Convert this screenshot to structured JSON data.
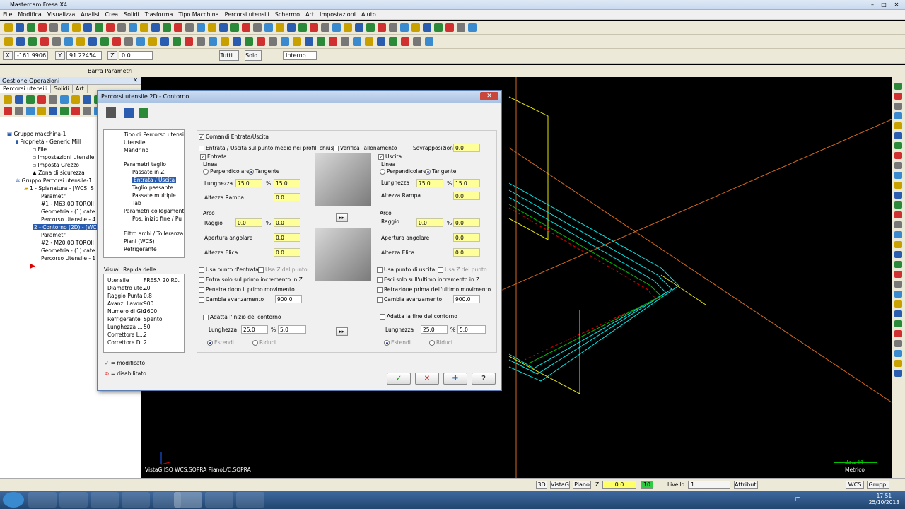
{
  "window": {
    "title": "Mastercam Fresa X4"
  },
  "menu": [
    "File",
    "Modifica",
    "Visualizza",
    "Analisi",
    "Crea",
    "Solidi",
    "Trasforma",
    "Tipo Macchina",
    "Percorsi utensili",
    "Schermo",
    "Art",
    "Impostazioni",
    "Aiuto"
  ],
  "coords": {
    "x_label": "X",
    "x_value": "-161.9906",
    "y_label": "Y",
    "y_value": "91.22454",
    "z_label": "Z",
    "z_value": "0.0",
    "tutti": "Tutti...",
    "solo": "Solo...",
    "mode": "Interno"
  },
  "ribbon": {
    "label": "Barra Parametri"
  },
  "left_panel": {
    "title": "Gestione Operazioni",
    "tabs": [
      "Percorsi utensili",
      "Solidi",
      "Art"
    ],
    "tree": [
      "Gruppo macchina-1",
      "Proprietà - Generic Mill",
      "File",
      "Impostazioni utensile",
      "Imposta Grezzo",
      "Zona di sicurezza",
      "Gruppo Percorsi utensile-1",
      "1 - Spianatura - [WCS: S",
      "Parametri",
      "#1 - M63.00 TOROII",
      "Geometria - (1) cate",
      "Percorso Utensile - 4",
      "2 - Contorno (2D) - [WC",
      "Parametri",
      "#2 - M20.00 TOROII",
      "Geometria - (1) cate",
      "Percorso Utensile - 1"
    ]
  },
  "dialog": {
    "title": "Percorsi utensile 2D - Contorno",
    "tree": [
      "Tipo di Percorso utensili",
      "Utensile",
      "Mandrino",
      "Parametri taglio",
      "Passate in Z",
      "Entrata / Uscita",
      "Taglio passante",
      "Passate multiple",
      "Tab",
      "Parametri collegamento",
      "Pos. inizio fine / Pu",
      "Filtro archi / Tolleranza",
      "Piani (WCS)",
      "Refrigerante"
    ],
    "quick_view_title": "Visual. Rapida delle",
    "quick_view": [
      [
        "Utensile",
        "FRESA 20 R0."
      ],
      [
        "Diametro ute...",
        "20"
      ],
      [
        "Raggio Punta",
        "0.8"
      ],
      [
        "Avanz. Lavoro",
        "900"
      ],
      [
        "Numero di Giri",
        "2600"
      ],
      [
        "Refrigerante",
        "Spento"
      ],
      [
        "Lunghezza ...",
        "50"
      ],
      [
        "Correttore L...",
        "2"
      ],
      [
        "Correttore Di...",
        "2"
      ]
    ],
    "legend": {
      "modified": "= modificato",
      "disabled": "= disabilitato"
    },
    "comandi": "Comandi  Entrata/Uscita",
    "mid_point": "Entrata / Uscita sul punto medio nei profili chiusi",
    "verifica": "Verifica Tallonamento",
    "sovrapp_label": "Sovrapposizione",
    "sovrapp_value": "0.0",
    "entrata": {
      "title": "Entrata",
      "linea": "Linea",
      "perp": "Perpendicolare",
      "tang": "Tangente",
      "lunghezza": "Lunghezza",
      "len_pct": "75.0",
      "len_val": "15.0",
      "altezza_rampa": "Altezza Rampa",
      "rampa_val": "0.0",
      "arco": "Arco",
      "raggio": "Raggio",
      "r_pct": "0.0",
      "r_val": "0.0",
      "apertura": "Apertura angolare",
      "apertura_val": "0.0",
      "elica": "Altezza Elica",
      "elica_val": "0.0",
      "usa_punto": "Usa punto d'entrata",
      "usa_z": "Usa Z del punto",
      "solo_primo": "Entra solo sul primo incremento in Z",
      "penetra": "Penetra dopo il primo movimento",
      "cambia": "Cambia avanzamento",
      "cambia_val": "900.0",
      "adatta": "Adatta l'inizio del contorno",
      "adatta_len": "Lunghezza",
      "adatta_pct": "25.0",
      "adatta_val": "5.0",
      "estendi": "Estendi",
      "riduci": "Riduci"
    },
    "uscita": {
      "title": "Uscita",
      "linea": "Linea",
      "perp": "Perpendicolare",
      "tang": "Tangente",
      "lunghezza": "Lunghezza",
      "len_pct": "75.0",
      "len_val": "15.0",
      "altezza_rampa": "Altezza Rampa",
      "rampa_val": "0.0",
      "arco": "Arco",
      "raggio": "Raggio",
      "r_pct": "0.0",
      "r_val": "0.0",
      "apertura": "Apertura angolare",
      "apertura_val": "0.0",
      "elica": "Altezza Elica",
      "elica_val": "0.0",
      "usa_punto": "Usa punto di uscita",
      "usa_z": "Usa Z del punto",
      "solo_ultimo": "Esci solo sull'ultimo incremento in Z",
      "retrazione": "Retrazione prima dell'ultimo movimento",
      "cambia": "Cambia avanzamento",
      "cambia_val": "900.0",
      "adatta": "Adatta la fine del contorno",
      "adatta_len": "Lunghezza",
      "adatta_pct": "25.0",
      "adatta_val": "5.0",
      "estendi": "Estendi",
      "riduci": "Riduci"
    }
  },
  "viewport": {
    "status": "VistaG:ISO   WCS:SOPRA   PianoL/C:SOPRA",
    "scale_value": "23.244",
    "scale_unit": "Metrico"
  },
  "statusbar": {
    "btn3d": "3D",
    "vistag": "VistaG",
    "piano": "Piano",
    "z_label": "Z:",
    "z_val": "0.0",
    "color": "10",
    "livello_label": "Livello:",
    "livello_val": "1",
    "attributi": "Attributi",
    "wcs": "WCS",
    "gruppi": "Gruppi"
  },
  "taskbar": {
    "time": "17:51",
    "date": "25/10/2013",
    "lang": "IT"
  },
  "colors": {
    "accent": "#2a5db0",
    "field": "#ffff99",
    "cyan": "#00e5e5",
    "yellow": "#e5e500",
    "orange": "#d2691e",
    "green": "#00c000",
    "red": "#e00000"
  }
}
